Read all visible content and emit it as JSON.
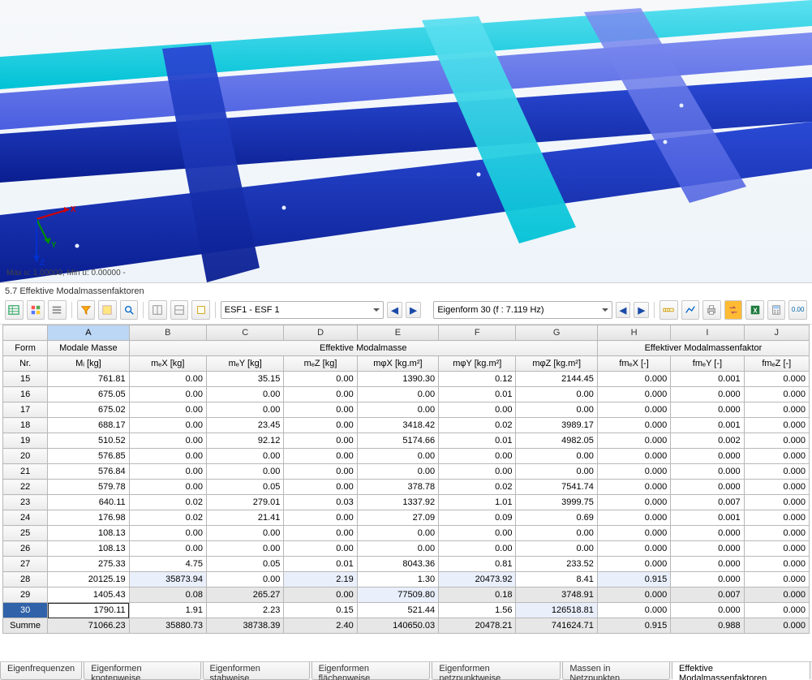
{
  "viewport": {
    "status_text": "Max u: 1.00000, Min u: 0.00000 -",
    "axis_x": "X",
    "axis_y": "Y",
    "axis_z": "Z"
  },
  "section_title": "5.7 Effektive Modalmassenfaktoren",
  "toolbar": {
    "combo1": "ESF1 - ESF 1",
    "combo2": "Eigenform 30 (f : 7.119 Hz)"
  },
  "columns": {
    "letters": [
      "A",
      "B",
      "C",
      "D",
      "E",
      "F",
      "G",
      "H",
      "I",
      "J"
    ],
    "group_form": "Form",
    "group_nr": "Nr.",
    "group_modale_masse": "Modale Masse",
    "group_mi": "Mᵢ [kg]",
    "group_eff_masse": "Effektive Modalmasse",
    "group_eff_faktor": "Effektiver Modalmassenfaktor",
    "sub": {
      "mex": "mₑX [kg]",
      "mey": "mₑY [kg]",
      "mez": "mₑZ [kg]",
      "mphix": "mφX [kg.m²]",
      "mphiy": "mφY [kg.m²]",
      "mphiz": "mφZ [kg.m²]",
      "fmex": "fmₑX [-]",
      "fmey": "fmₑY [-]",
      "fmez": "fmₑZ [-]"
    }
  },
  "rows": [
    {
      "n": "15",
      "A": "761.81",
      "B": "0.00",
      "C": "35.15",
      "D": "0.00",
      "E": "1390.30",
      "F": "0.12",
      "G": "2144.45",
      "H": "0.000",
      "I": "0.001",
      "J": "0.000"
    },
    {
      "n": "16",
      "A": "675.05",
      "B": "0.00",
      "C": "0.00",
      "D": "0.00",
      "E": "0.00",
      "F": "0.01",
      "G": "0.00",
      "H": "0.000",
      "I": "0.000",
      "J": "0.000"
    },
    {
      "n": "17",
      "A": "675.02",
      "B": "0.00",
      "C": "0.00",
      "D": "0.00",
      "E": "0.00",
      "F": "0.00",
      "G": "0.00",
      "H": "0.000",
      "I": "0.000",
      "J": "0.000"
    },
    {
      "n": "18",
      "A": "688.17",
      "B": "0.00",
      "C": "23.45",
      "D": "0.00",
      "E": "3418.42",
      "F": "0.02",
      "G": "3989.17",
      "H": "0.000",
      "I": "0.001",
      "J": "0.000"
    },
    {
      "n": "19",
      "A": "510.52",
      "B": "0.00",
      "C": "92.12",
      "D": "0.00",
      "E": "5174.66",
      "F": "0.01",
      "G": "4982.05",
      "H": "0.000",
      "I": "0.002",
      "J": "0.000"
    },
    {
      "n": "20",
      "A": "576.85",
      "B": "0.00",
      "C": "0.00",
      "D": "0.00",
      "E": "0.00",
      "F": "0.00",
      "G": "0.00",
      "H": "0.000",
      "I": "0.000",
      "J": "0.000"
    },
    {
      "n": "21",
      "A": "576.84",
      "B": "0.00",
      "C": "0.00",
      "D": "0.00",
      "E": "0.00",
      "F": "0.00",
      "G": "0.00",
      "H": "0.000",
      "I": "0.000",
      "J": "0.000"
    },
    {
      "n": "22",
      "A": "579.78",
      "B": "0.00",
      "C": "0.05",
      "D": "0.00",
      "E": "378.78",
      "F": "0.02",
      "G": "7541.74",
      "H": "0.000",
      "I": "0.000",
      "J": "0.000"
    },
    {
      "n": "23",
      "A": "640.11",
      "B": "0.02",
      "C": "279.01",
      "D": "0.03",
      "E": "1337.92",
      "F": "1.01",
      "G": "3999.75",
      "H": "0.000",
      "I": "0.007",
      "J": "0.000"
    },
    {
      "n": "24",
      "A": "176.98",
      "B": "0.02",
      "C": "21.41",
      "D": "0.00",
      "E": "27.09",
      "F": "0.09",
      "G": "0.69",
      "H": "0.000",
      "I": "0.001",
      "J": "0.000"
    },
    {
      "n": "25",
      "A": "108.13",
      "B": "0.00",
      "C": "0.00",
      "D": "0.00",
      "E": "0.00",
      "F": "0.00",
      "G": "0.00",
      "H": "0.000",
      "I": "0.000",
      "J": "0.000"
    },
    {
      "n": "26",
      "A": "108.13",
      "B": "0.00",
      "C": "0.00",
      "D": "0.00",
      "E": "0.00",
      "F": "0.00",
      "G": "0.00",
      "H": "0.000",
      "I": "0.000",
      "J": "0.000"
    },
    {
      "n": "27",
      "A": "275.33",
      "B": "4.75",
      "C": "0.05",
      "D": "0.01",
      "E": "8043.36",
      "F": "0.81",
      "G": "233.52",
      "H": "0.000",
      "I": "0.000",
      "J": "0.000"
    },
    {
      "n": "28",
      "A": "20125.19",
      "B": "35873.94",
      "C": "0.00",
      "D": "2.19",
      "E": "1.30",
      "F": "20473.92",
      "G": "8.41",
      "H": "0.915",
      "I": "0.000",
      "J": "0.000",
      "tint": [
        "B",
        "D",
        "F",
        "H"
      ]
    },
    {
      "n": "29",
      "A": "1405.43",
      "B": "0.08",
      "C": "265.27",
      "D": "0.00",
      "E": "77509.80",
      "F": "0.18",
      "G": "3748.91",
      "H": "0.000",
      "I": "0.007",
      "J": "0.000",
      "tint": [
        "E"
      ],
      "grey": true
    },
    {
      "n": "30",
      "A": "1790.11",
      "B": "1.91",
      "C": "2.23",
      "D": "0.15",
      "E": "521.44",
      "F": "1.56",
      "G": "126518.81",
      "H": "0.000",
      "I": "0.000",
      "J": "0.000",
      "tint": [
        "G"
      ],
      "selected": true
    }
  ],
  "summary": {
    "label": "Summe",
    "A": "71066.23",
    "B": "35880.73",
    "C": "38738.39",
    "D": "2.40",
    "E": "140650.03",
    "F": "20478.21",
    "G": "741624.71",
    "H": "0.915",
    "I": "0.988",
    "J": "0.000"
  },
  "tabs": {
    "items": [
      "Eigenfrequenzen",
      "Eigenformen knotenweise",
      "Eigenformen stabweise",
      "Eigenformen flächenweise",
      "Eigenformen netzpunktweise",
      "Massen in Netzpunkten",
      "Effektive Modalmassenfaktoren"
    ],
    "active_index": 6
  }
}
